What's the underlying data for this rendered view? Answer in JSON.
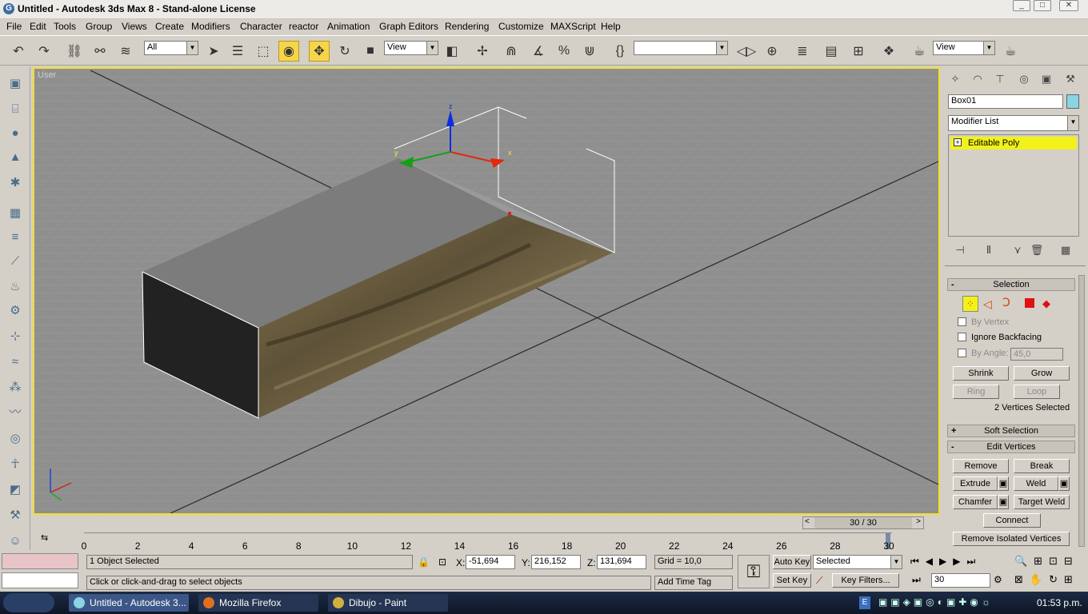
{
  "window": {
    "title": "Untitled - Autodesk 3ds Max 8 - Stand-alone License",
    "icon": "app-g-icon"
  },
  "menu": [
    "File",
    "Edit",
    "Tools",
    "Group",
    "Views",
    "Create",
    "Modifiers",
    "Character",
    "reactor",
    "Animation",
    "Graph Editors",
    "Rendering",
    "Customize",
    "MAXScript",
    "Help"
  ],
  "toolbar": {
    "selection_filter": "All",
    "ref_coord": "View",
    "named_set": "",
    "render_view": "View"
  },
  "viewport": {
    "label": "User",
    "gizmo": {
      "x": "x",
      "y": "y",
      "z": "z"
    }
  },
  "command_panel": {
    "object_name": "Box01",
    "modifier_list": "Modifier List",
    "stack_item": "Editable Poly",
    "selection": {
      "title": "Selection",
      "by_vertex": "By Vertex",
      "ignore_backfacing": "Ignore Backfacing",
      "by_angle": "By Angle:",
      "angle_value": "45,0",
      "shrink": "Shrink",
      "grow": "Grow",
      "ring": "Ring",
      "loop": "Loop",
      "status": "2 Vertices Selected"
    },
    "soft_selection": "Soft Selection",
    "edit_vertices": {
      "title": "Edit Vertices",
      "remove": "Remove",
      "break": "Break",
      "extrude": "Extrude",
      "weld": "Weld",
      "chamfer": "Chamfer",
      "target_weld": "Target Weld",
      "connect": "Connect",
      "remove_isolated": "Remove Isolated Vertices"
    }
  },
  "time_slider": {
    "frame_label": "30 / 30",
    "ticks": [
      "0",
      "2",
      "4",
      "6",
      "8",
      "10",
      "12",
      "14",
      "16",
      "18",
      "20",
      "22",
      "24",
      "26",
      "28",
      "30"
    ]
  },
  "status": {
    "selected": "1 Object Selected",
    "prompt": "Click or click-and-drag to select objects",
    "x_label": "X:",
    "x": "-51,694",
    "y_label": "Y:",
    "y": "216,152",
    "z_label": "Z:",
    "z": "131,694",
    "grid": "Grid = 10,0",
    "add_time_tag": "Add Time Tag",
    "auto_key": "Auto Key",
    "set_key": "Set Key",
    "key_mode": "Selected",
    "key_filters": "Key Filters...",
    "frame": "30"
  },
  "taskbar": {
    "tasks": [
      "Untitled - Autodesk 3...",
      "Mozilla Firefox",
      "Dibujo - Paint"
    ],
    "clock": "01:53 p.m.",
    "lang": "E"
  }
}
